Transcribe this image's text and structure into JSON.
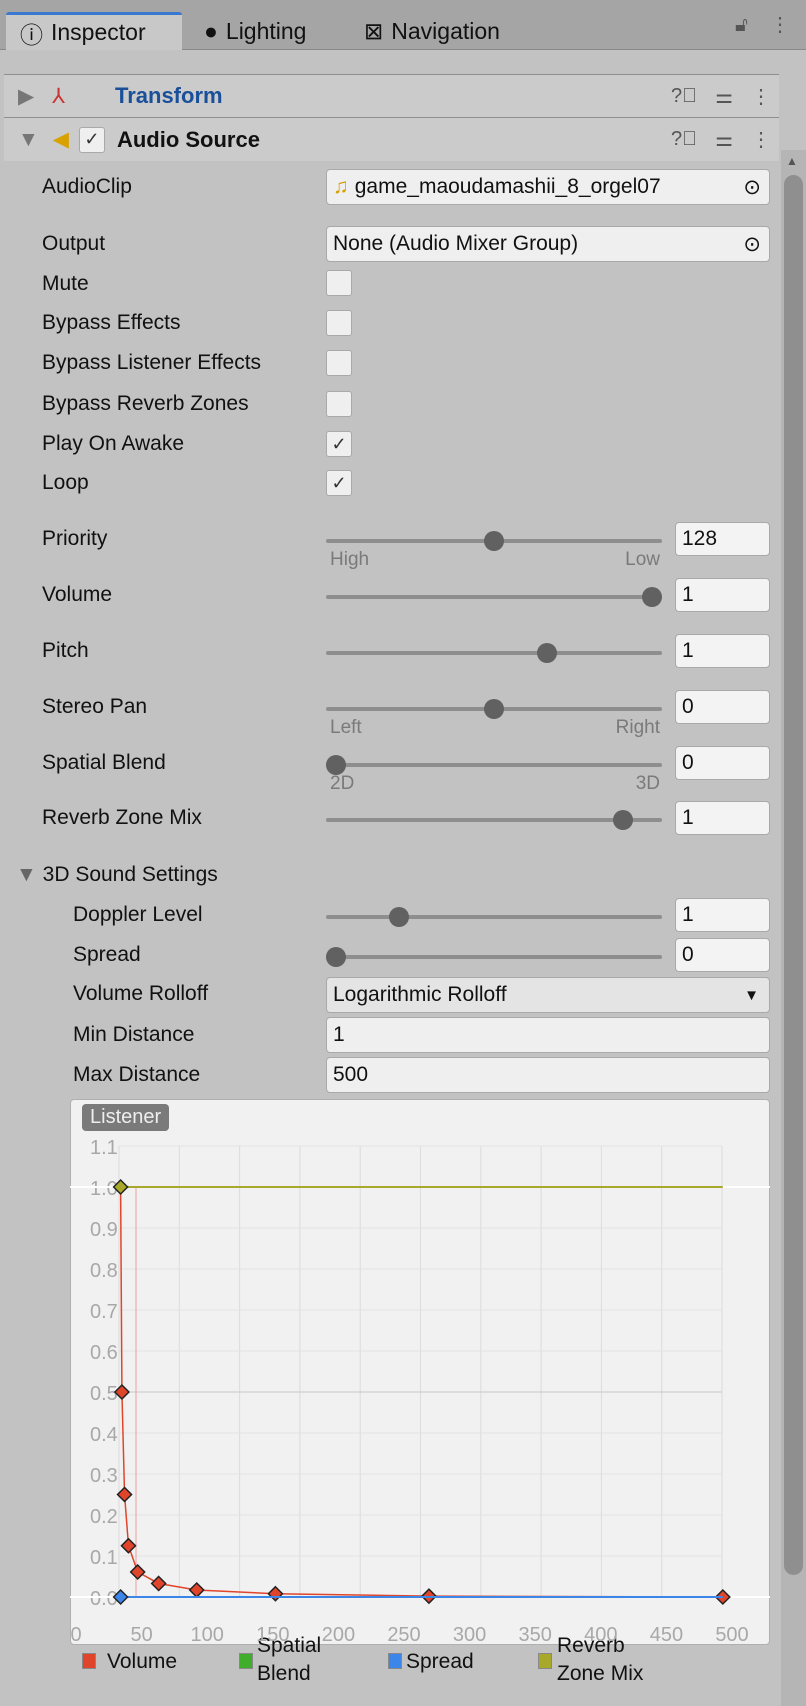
{
  "tabs": [
    {
      "label": "Inspector",
      "icon": "info-icon"
    },
    {
      "label": "Lighting",
      "icon": "bulb-icon"
    },
    {
      "label": "Navigation",
      "icon": "navigation-icon"
    }
  ],
  "components": {
    "transform": {
      "title": "Transform"
    },
    "audio_source": {
      "title": "Audio Source",
      "enabled": true
    }
  },
  "fields": {
    "audio_clip": {
      "label": "AudioClip",
      "value": "game_maoudamashii_8_orgel07"
    },
    "output": {
      "label": "Output",
      "value": "None (Audio Mixer Group)"
    },
    "mute": {
      "label": "Mute",
      "checked": false
    },
    "bypass_effects": {
      "label": "Bypass Effects",
      "checked": false
    },
    "bypass_listener": {
      "label": "Bypass Listener Effects",
      "checked": false
    },
    "bypass_reverb": {
      "label": "Bypass Reverb Zones",
      "checked": false
    },
    "play_on_awake": {
      "label": "Play On Awake",
      "checked": true
    },
    "loop": {
      "label": "Loop",
      "checked": true
    }
  },
  "sliders": [
    {
      "label": "Priority",
      "value": "128",
      "fraction": 0.5,
      "min_label": "High",
      "max_label": "Low"
    },
    {
      "label": "Volume",
      "value": "1",
      "fraction": 1
    },
    {
      "label": "Pitch",
      "value": "1",
      "fraction": 0.667
    },
    {
      "label": "Stereo Pan",
      "value": "0",
      "fraction": 0.5,
      "min_label": "Left",
      "max_label": "Right"
    },
    {
      "label": "Spatial Blend",
      "value": "0",
      "fraction": 0,
      "min_label": "2D",
      "max_label": "3D"
    },
    {
      "label": "Reverb Zone Mix",
      "value": "1",
      "fraction": 0.909
    }
  ],
  "sound3d": {
    "title": "3D Sound Settings",
    "doppler": {
      "label": "Doppler Level",
      "value": "1",
      "fraction": 0.2
    },
    "spread": {
      "label": "Spread",
      "value": "0",
      "fraction": 0
    },
    "rolloff": {
      "label": "Volume Rolloff",
      "value": "Logarithmic Rolloff"
    },
    "min_distance": {
      "label": "Min Distance",
      "value": "1"
    },
    "max_distance": {
      "label": "Max Distance",
      "value": "500"
    }
  },
  "chart_data": {
    "type": "line",
    "badge": "Listener",
    "xticks": [
      "0",
      "50",
      "100",
      "150",
      "200",
      "250",
      "300",
      "350",
      "400",
      "450",
      "500"
    ],
    "yticks": [
      "0.0",
      "0.1",
      "0.2",
      "0.3",
      "0.4",
      "0.5",
      "0.6",
      "0.7",
      "0.8",
      "0.9",
      "1.0",
      "1.1"
    ],
    "xlim": [
      0,
      530
    ],
    "ylim": [
      0,
      1.1
    ],
    "grid": true,
    "legend_placement": "bottom",
    "series": [
      {
        "name": "Volume",
        "color": "#e0452b",
        "x": [
          35,
          37,
          40,
          47,
          63,
          92,
          152,
          269,
          493
        ],
        "y": [
          0.5,
          0.25,
          0.125,
          0.061,
          0.033,
          0.017,
          0.008,
          0.002,
          0
        ]
      },
      {
        "name": "Spatial Blend",
        "color": "#3fae2a",
        "x": [],
        "y": []
      },
      {
        "name": "Spread",
        "color": "#3b86e8",
        "x": [
          34,
          493
        ],
        "y": [
          0,
          0
        ]
      },
      {
        "name": "Reverb Zone Mix",
        "color": "#a8a82a",
        "x": [
          34,
          493
        ],
        "y": [
          1,
          1
        ]
      }
    ],
    "legend": [
      "Volume",
      "Spatial Blend",
      "Spread",
      "Reverb Zone Mix"
    ]
  },
  "colors": {
    "accent": "#3a79d0",
    "transform_title": "#1a4f9a",
    "audio_icon": "#d9a100"
  }
}
